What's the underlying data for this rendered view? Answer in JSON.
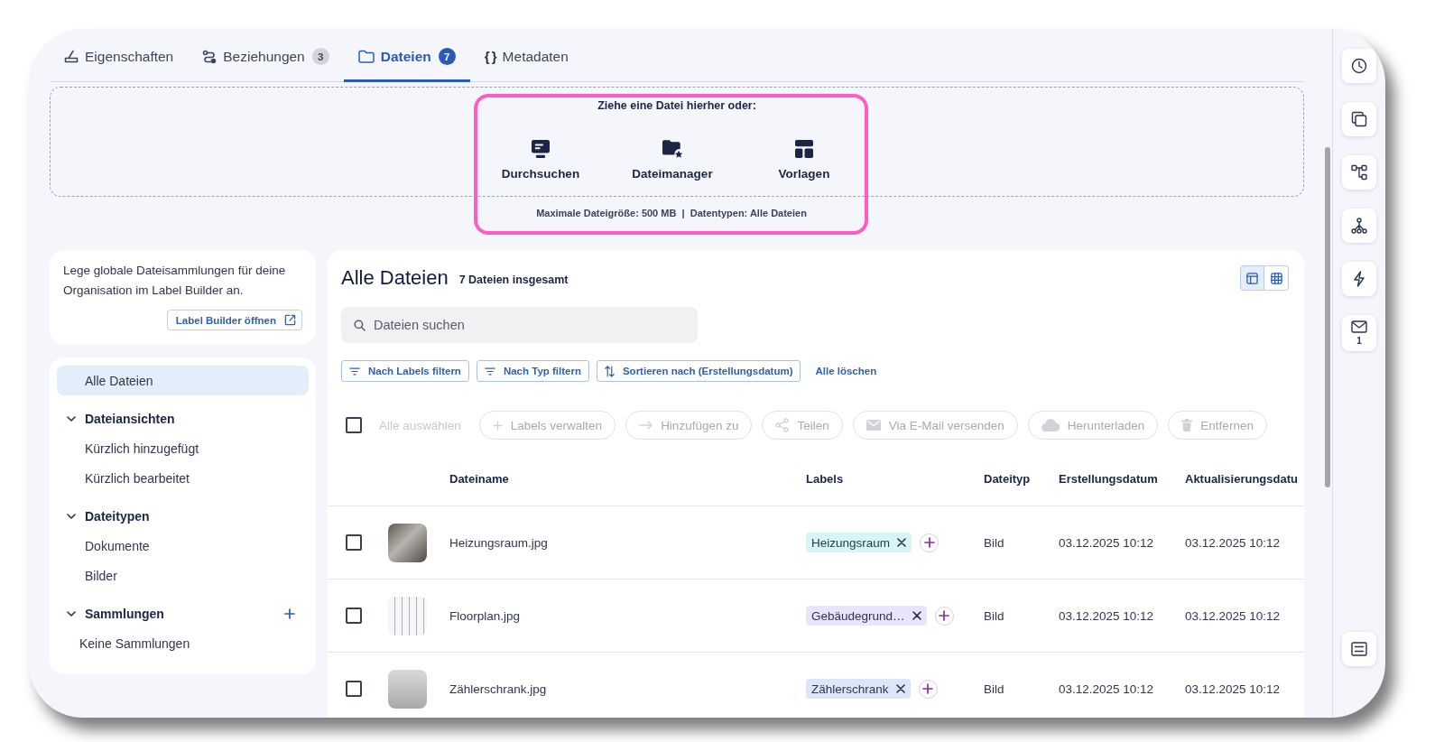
{
  "tabs": [
    {
      "label": "Eigenschaften",
      "selected": false
    },
    {
      "label": "Beziehungen",
      "badge": "3",
      "selected": false
    },
    {
      "label": "Dateien",
      "badge": "7",
      "selected": true
    },
    {
      "label": "Metadaten",
      "glyph": "{ }",
      "selected": false
    }
  ],
  "dropzone": {
    "prompt": "Ziehe eine Datei hierher oder:",
    "options": [
      {
        "label": "Durchsuchen"
      },
      {
        "label": "Dateimanager"
      },
      {
        "label": "Vorlagen"
      }
    ],
    "limits": "Maximale Dateigröße: 500 MB  |  Datentypen: Alle Dateien",
    "highlighted": true
  },
  "sidebar": {
    "info": {
      "text": "Lege globale Dateisammlungen für deine Organisation im Label Builder an.",
      "button": "Label Builder öffnen"
    },
    "nav": [
      {
        "kind": "item",
        "label": "Alle Dateien",
        "selected": true
      },
      {
        "kind": "section",
        "label": "Dateiansichten",
        "expanded": true,
        "children": [
          {
            "label": "Kürzlich hinzugefügt",
            "selected": false
          },
          {
            "label": "Kürzlich bearbeitet",
            "selected": false
          }
        ]
      },
      {
        "kind": "section",
        "label": "Dateitypen",
        "expanded": true,
        "children": [
          {
            "label": "Dokumente",
            "selected": false
          },
          {
            "label": "Bilder",
            "selected": false
          }
        ]
      },
      {
        "kind": "section",
        "label": "Sammlungen",
        "expanded": true,
        "can_add": true,
        "empty_text": "Keine Sammlungen"
      }
    ]
  },
  "files": {
    "title": "Alle Dateien",
    "count": "7 Dateien insgesamt",
    "views": [
      {
        "kind": "table",
        "selected": true
      },
      {
        "kind": "grid",
        "selected": false
      }
    ],
    "search": {
      "placeholder": "Dateien suchen"
    },
    "filters": [
      {
        "kind": "filter",
        "label": "Nach Labels filtern"
      },
      {
        "kind": "filter",
        "label": "Nach Typ filtern"
      },
      {
        "kind": "sort",
        "label": "Sortieren nach (Erstellungsdatum)"
      },
      {
        "kind": "link",
        "label": "Alle löschen"
      }
    ],
    "select_all": {
      "label": "Alle auswählen",
      "checked": false,
      "disabled": true
    },
    "actions": [
      {
        "kind": "add",
        "label": "Labels verwalten",
        "disabled": true
      },
      {
        "kind": "move",
        "label": "Hinzufügen zu",
        "disabled": true
      },
      {
        "kind": "share",
        "label": "Teilen",
        "disabled": true
      },
      {
        "kind": "mail",
        "label": "Via E-Mail versenden",
        "disabled": true
      },
      {
        "kind": "download",
        "label": "Herunterladen",
        "disabled": true
      },
      {
        "kind": "delete",
        "label": "Entfernen",
        "disabled": true
      }
    ]
  },
  "table": {
    "columns": [
      "Dateiname",
      "Labels",
      "Dateityp",
      "Erstellungsdatum",
      "Aktualisierungsdatu"
    ],
    "rows": [
      {
        "checked": false,
        "name": "Heizungsraum.jpg",
        "labels": [
          {
            "text": "Heizungsraum",
            "color": "#d7f5f7"
          }
        ],
        "type": "Bild",
        "created": "03.12.2025 10:12",
        "updated": "03.12.2025 10:12"
      },
      {
        "checked": false,
        "name": "Floorplan.jpg",
        "labels": [
          {
            "text": "Gebäudegrund…",
            "color": "#e9e4fa"
          }
        ],
        "type": "Bild",
        "created": "03.12.2025 10:12",
        "updated": "03.12.2025 10:12"
      },
      {
        "checked": false,
        "name": "Zählerschrank.jpg",
        "labels": [
          {
            "text": "Zählerschrank",
            "color": "#dbe6fa"
          }
        ],
        "type": "Bild",
        "created": "03.12.2025 10:12",
        "updated": "03.12.2025 10:12"
      }
    ]
  },
  "rail": [
    {
      "kind": "history"
    },
    {
      "kind": "copy"
    },
    {
      "kind": "tree"
    },
    {
      "kind": "network"
    },
    {
      "kind": "bolt"
    },
    {
      "kind": "mail",
      "count": "1"
    },
    {
      "kind": "list"
    }
  ]
}
